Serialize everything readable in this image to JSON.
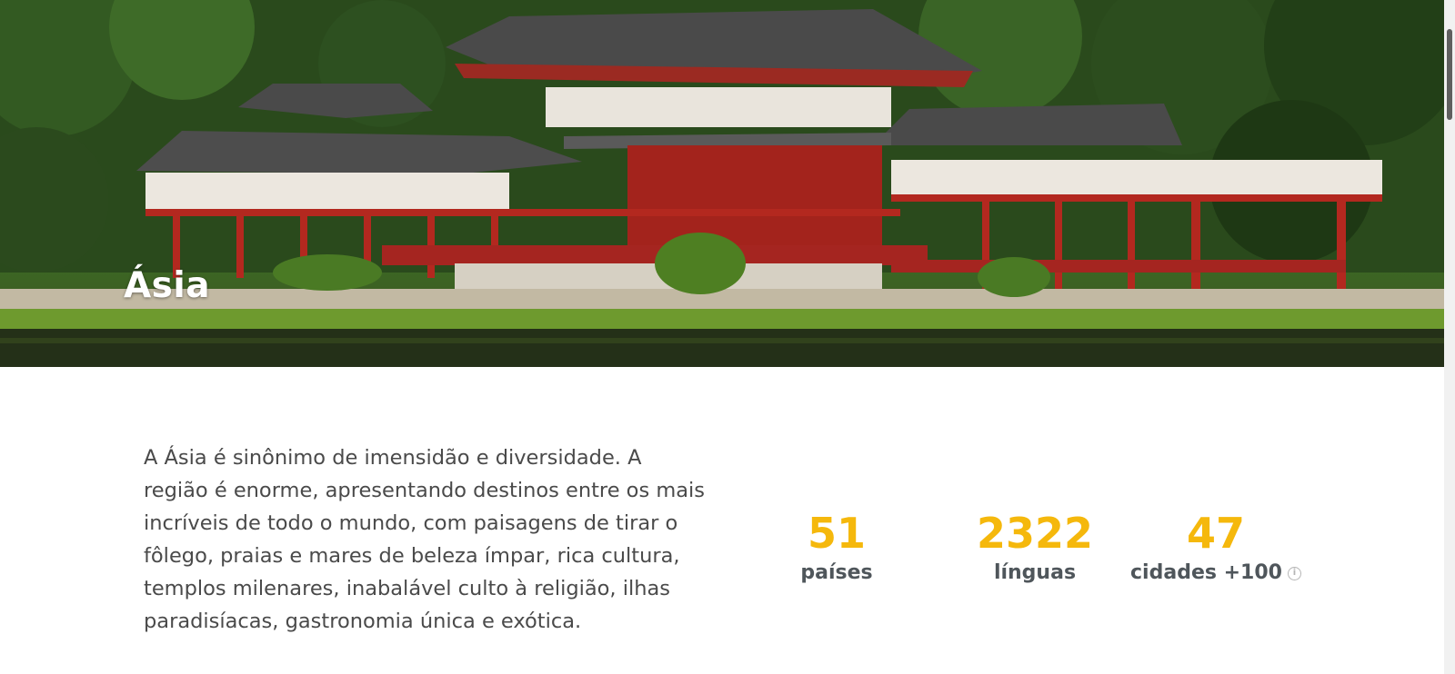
{
  "hero": {
    "title": "Ásia"
  },
  "description": "A Ásia é sinônimo de imensidão e diversidade. A região é enorme, apresentando destinos entre os mais incríveis de todo o mundo, com paisagens de tirar o fôlego, praias e mares de beleza ímpar, rica cultura, templos milenares, inabalável culto à religião, ilhas paradisíacas, gastronomia única e exótica.",
  "stats": [
    {
      "value": "51",
      "label": "países"
    },
    {
      "value": "2322",
      "label": "línguas"
    },
    {
      "value": "47",
      "label": "cidades +100",
      "icon": "info-icon"
    }
  ],
  "colors": {
    "accent": "#f5b80c",
    "stat_label": "#4f565b",
    "body_text": "#4a4a4a"
  }
}
